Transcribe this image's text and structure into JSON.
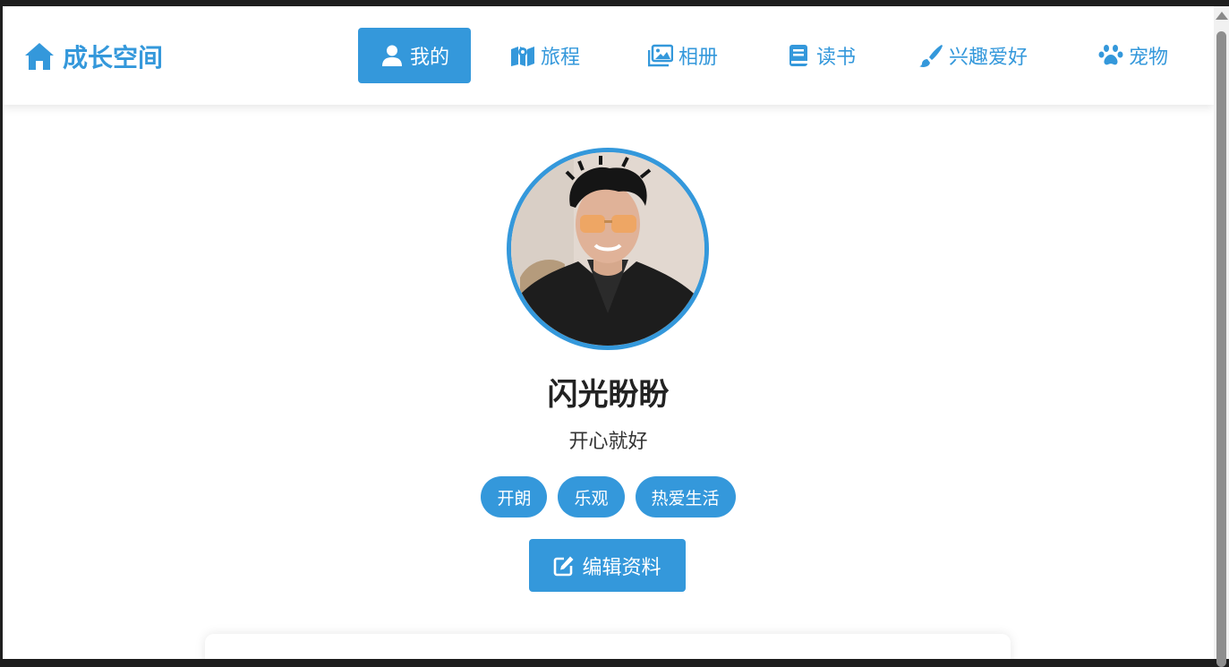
{
  "logo": {
    "text": "成长空间",
    "icon": "home-icon"
  },
  "nav": {
    "items": [
      {
        "label": "我的",
        "icon": "user-icon",
        "active": true
      },
      {
        "label": "旅程",
        "icon": "map-icon",
        "active": false
      },
      {
        "label": "相册",
        "icon": "images-icon",
        "active": false
      },
      {
        "label": "读书",
        "icon": "book-icon",
        "active": false
      },
      {
        "label": "兴趣爱好",
        "icon": "paintbrush-icon",
        "active": false
      },
      {
        "label": "宠物",
        "icon": "paw-icon",
        "active": false
      }
    ]
  },
  "profile": {
    "name": "闪光盼盼",
    "motto": "开心就好",
    "tags": [
      "开朗",
      "乐观",
      "热爱生活"
    ],
    "edit_label": "编辑资料"
  },
  "colors": {
    "accent": "#3498db",
    "text": "#222222",
    "background": "#ffffff"
  }
}
